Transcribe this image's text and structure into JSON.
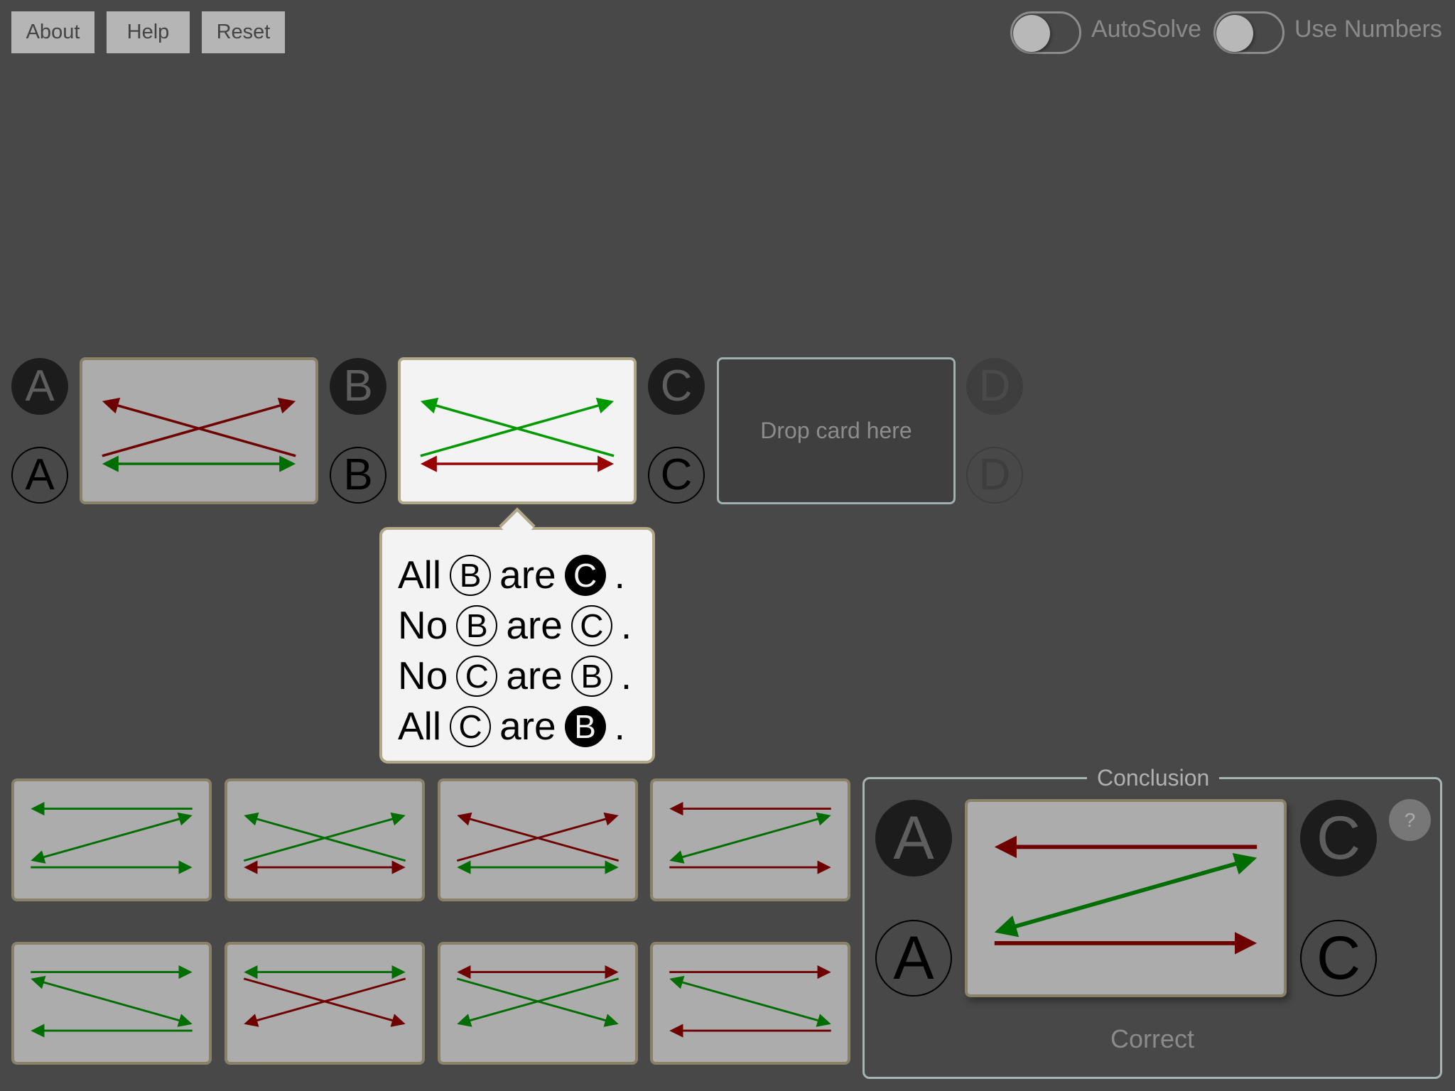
{
  "toolbar": {
    "about_label": "About",
    "help_label": "Help",
    "reset_label": "Reset"
  },
  "toggles": {
    "autosolve": {
      "label": "AutoSolve",
      "on": false
    },
    "use_numbers": {
      "label": "Use Numbers",
      "on": false
    }
  },
  "colors": {
    "background": "#484848",
    "card_bg": "#acacac",
    "card_selected_bg": "#f3f3f3",
    "card_border": "#8a8268",
    "red_arrow": "#6f0000",
    "green_arrow": "#006d00",
    "bright_red_arrow": "#990000",
    "bright_green_arrow": "#009900"
  },
  "syllogism": {
    "terms": [
      "A",
      "B",
      "C",
      "D"
    ],
    "premise_cards": [
      {
        "between": [
          "A",
          "B"
        ],
        "pattern": "x-red-bottom-green",
        "state": "placed"
      },
      {
        "between": [
          "B",
          "C"
        ],
        "pattern": "x-green-bottom-red",
        "state": "selected"
      }
    ],
    "drop_zone": {
      "between": [
        "C",
        "D"
      ],
      "label": "Drop card here"
    },
    "disabled_term": "D"
  },
  "popover": {
    "lines": [
      {
        "quant": "All",
        "subj": "B",
        "subj_style": "outline",
        "verb": "are",
        "obj": "C",
        "obj_style": "filled"
      },
      {
        "quant": "No",
        "subj": "B",
        "subj_style": "outline",
        "verb": "are",
        "obj": "C",
        "obj_style": "outline"
      },
      {
        "quant": "No",
        "subj": "C",
        "subj_style": "outline",
        "verb": "are",
        "obj": "B",
        "obj_style": "outline"
      },
      {
        "quant": "All",
        "subj": "C",
        "subj_style": "outline",
        "verb": "are",
        "obj": "B",
        "obj_style": "filled"
      }
    ]
  },
  "palette": {
    "cards": [
      {
        "pattern": "z-green-red",
        "row": 1
      },
      {
        "pattern": "x-green-bottom-red",
        "row": 1
      },
      {
        "pattern": "x-red-bottom-green",
        "row": 1
      },
      {
        "pattern": "z-red-green",
        "row": 1
      },
      {
        "pattern": "zr-green-red",
        "row": 2
      },
      {
        "pattern": "xt-red-top-green",
        "row": 2
      },
      {
        "pattern": "xt-green-top-red",
        "row": 2
      },
      {
        "pattern": "zr-red-green",
        "row": 2
      }
    ]
  },
  "conclusion": {
    "legend": "Conclusion",
    "terms": [
      "A",
      "C"
    ],
    "pattern": "z-red-green",
    "help_label": "?",
    "result": "Correct"
  }
}
